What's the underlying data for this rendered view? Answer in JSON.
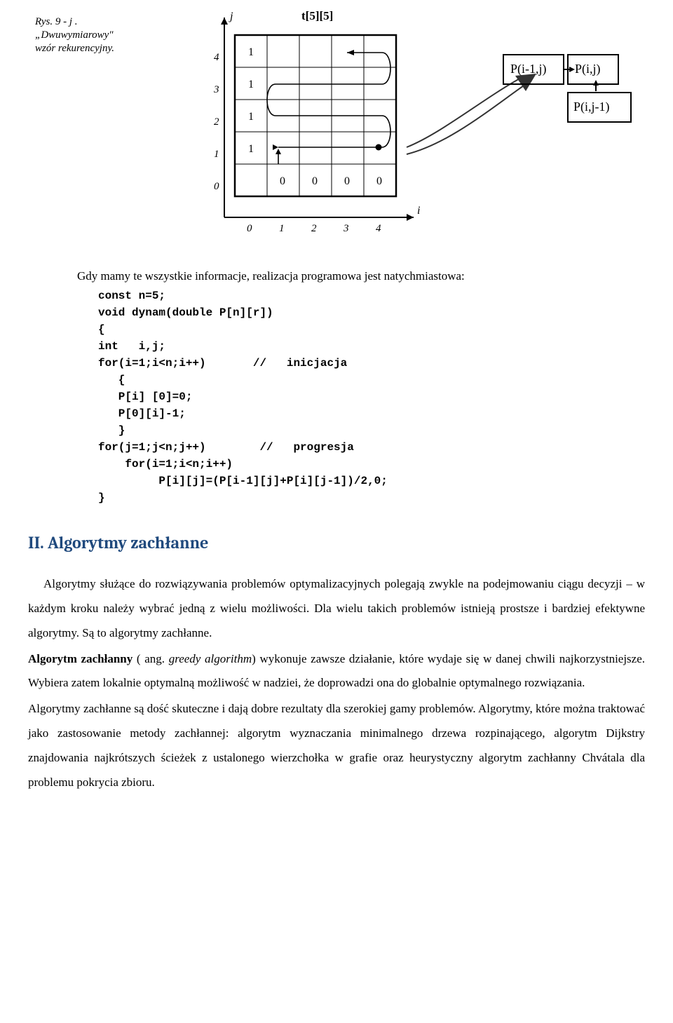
{
  "figure": {
    "caption_line1": "Rys. 9 - j .",
    "caption_line2": "„Dwuwymiarowy\"",
    "caption_line3": "wzór rekurencyjny.",
    "top_label": "t[5][5]",
    "axis_j": "j",
    "axis_i": "i",
    "y_ticks": [
      "0",
      "1",
      "2",
      "3",
      "4"
    ],
    "x_ticks": [
      "0",
      "1",
      "2",
      "3",
      "4"
    ],
    "col0_values": [
      "1",
      "1",
      "1",
      "1"
    ],
    "row0_values": [
      "0",
      "0",
      "0",
      "0"
    ],
    "side_cells": {
      "top_left": "P(i-1,j)",
      "top_right": "P(i,j)",
      "bottom_right": "P(i,j-1)"
    }
  },
  "intro": "Gdy mamy te wszystkie informacje, realizacja programowa jest natychmiastowa:",
  "code": {
    "l1": "const n=5;",
    "l2": "void dynam(double P[n][r])",
    "l3": "{",
    "l4": "int   i,j;",
    "l5a": "for(i=1;i<n;i++)",
    "l5b": "//   inicjacja",
    "l6": "   {",
    "l7": "   P[i] [0]=0;",
    "l8": "   P[0][i]-1;",
    "l9": "   }",
    "l10a": "for(j=1;j<n;j++)",
    "l10b": "//   progresja",
    "l11": "    for(i=1;i<n;i++)",
    "l12": "         P[i][j]=(P[i-1][j]+P[i][j-1])/2,0;",
    "l13": "}"
  },
  "section_title": "II. Algorytmy zachłanne",
  "para1a": "Algorytmy służące do rozwiązywania problemów optymalizacyjnych polegają zwykle na podejmowaniu ciągu decyzji – w każdym kroku należy wybrać jedną z wielu możliwości. Dla wielu takich problemów istnieją prostsze i bardziej efektywne algorytmy. Są to algorytmy zachłanne.",
  "para2_label": " Algorytm zachłanny",
  "para2_paren": " ( ang. ",
  "para2_italic": "greedy algorithm",
  "para2_rest": ") wykonuje zawsze działanie, które wydaje się w danej chwili najkorzystniejsze. Wybiera zatem lokalnie optymalną możliwość w nadziei, że doprowadzi ona do globalnie optymalnego rozwiązania.",
  "para3": "Algorytmy zachłanne są dość skuteczne i dają dobre rezultaty dla szerokiej gamy problemów. Algorytmy, które można traktować jako zastosowanie metody zachłannej: algorytm wyznaczania minimalnego drzewa rozpinającego, algorytm Dijkstry znajdowania najkrótszych ścieżek z ustalonego wierzchołka w grafie oraz heurystyczny algorytm zachłanny Chvátala dla problemu pokrycia zbioru."
}
